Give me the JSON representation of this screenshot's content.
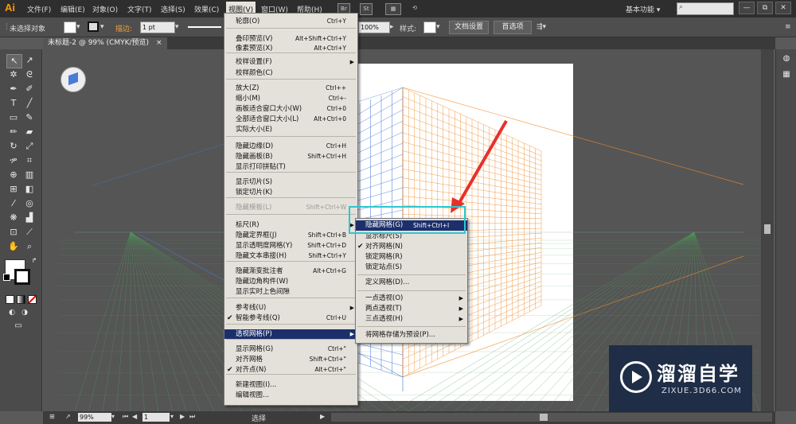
{
  "app": {
    "logo": "Ai",
    "workspace": "基本功能"
  },
  "menubar": {
    "items": [
      "文件(F)",
      "编辑(E)",
      "对象(O)",
      "文字(T)",
      "选择(S)",
      "效果(C)",
      "视图(V)",
      "窗口(W)",
      "帮助(H)"
    ],
    "toolbar_icons": [
      "Br",
      "St",
      "layout-icon",
      "sync-icon"
    ]
  },
  "window_buttons": {
    "minimize": "—",
    "restore": "⧉",
    "close": "✕"
  },
  "control_bar": {
    "selection": "未选择对象",
    "stroke_label": "描边:",
    "stroke_value": "1 pt",
    "zoom": "100%",
    "style_label": "样式:",
    "doc_settings": "文档设置",
    "preferences": "首选项"
  },
  "document_tab": {
    "title": "未标题-2 @ 99% (CMYK/预览)",
    "close": "×"
  },
  "view_menu": {
    "items": [
      {
        "label": "轮廓(O)",
        "shortcut": "Ctrl+Y"
      },
      {
        "label": "叠印预览(V)",
        "shortcut": "Alt+Shift+Ctrl+Y"
      },
      {
        "label": "像素预览(X)",
        "shortcut": "Alt+Ctrl+Y"
      },
      {
        "label": "校样设置(F)",
        "submenu": true
      },
      {
        "label": "校样颜色(C)"
      },
      {
        "label": "放大(Z)",
        "shortcut": "Ctrl++"
      },
      {
        "label": "缩小(M)",
        "shortcut": "Ctrl+-"
      },
      {
        "label": "画板适合窗口大小(W)",
        "shortcut": "Ctrl+0"
      },
      {
        "label": "全部适合窗口大小(L)",
        "shortcut": "Alt+Ctrl+0"
      },
      {
        "label": "实际大小(E)"
      },
      {
        "label": "隐藏边缘(D)",
        "shortcut": "Ctrl+H"
      },
      {
        "label": "隐藏画板(B)",
        "shortcut": "Shift+Ctrl+H"
      },
      {
        "label": "显示打印拼贴(T)"
      },
      {
        "label": "显示切片(S)"
      },
      {
        "label": "锁定切片(K)"
      },
      {
        "label": "隐藏模板(L)",
        "shortcut": "Shift+Ctrl+W",
        "disabled": true
      },
      {
        "label": "标尺(R)",
        "submenu": true
      },
      {
        "label": "隐藏定界框(J)",
        "shortcut": "Shift+Ctrl+B"
      },
      {
        "label": "显示透明度网格(Y)",
        "shortcut": "Shift+Ctrl+D"
      },
      {
        "label": "隐藏文本串接(H)",
        "shortcut": "Shift+Ctrl+Y"
      },
      {
        "label": "隐藏渐变批注者",
        "shortcut": "Alt+Ctrl+G"
      },
      {
        "label": "隐藏边角构件(W)"
      },
      {
        "label": "显示实时上色间隙"
      },
      {
        "label": "参考线(U)",
        "submenu": true
      },
      {
        "label": "智能参考线(Q)",
        "shortcut": "Ctrl+U",
        "checked": true
      },
      {
        "label": "透视网格(P)",
        "submenu": true,
        "highlighted": true
      },
      {
        "label": "显示网格(G)",
        "shortcut": "Ctrl+\""
      },
      {
        "label": "对齐网格",
        "shortcut": "Shift+Ctrl+\""
      },
      {
        "label": "对齐点(N)",
        "shortcut": "Alt+Ctrl+\"",
        "checked": true
      },
      {
        "label": "新建视图(I)..."
      },
      {
        "label": "编辑视图..."
      }
    ]
  },
  "perspective_submenu": {
    "items": [
      {
        "label": "隐藏网格(G)",
        "shortcut": "Shift+Ctrl+I",
        "highlighted": true
      },
      {
        "label": "显示标尺(S)"
      },
      {
        "label": "对齐网格(N)",
        "checked": true
      },
      {
        "label": "锁定网格(R)"
      },
      {
        "label": "锁定站点(S)"
      },
      {
        "label": "定义网格(D)..."
      },
      {
        "label": "一点透视(O)",
        "submenu": true
      },
      {
        "label": "两点透视(T)",
        "submenu": true
      },
      {
        "label": "三点透视(H)",
        "submenu": true
      },
      {
        "label": "将网格存储为预设(P)..."
      }
    ]
  },
  "status_bar": {
    "zoom": "99%",
    "page": "1",
    "tool": "选择"
  },
  "watermark": {
    "title": "溜溜自学",
    "url": "ZIXUE.3D66.COM"
  },
  "colors": {
    "accent_highlight": "#1d2f6b",
    "callout_box": "#2ec7cf",
    "arrow": "#e8302a",
    "grid_blue": "#4a7bd6",
    "grid_orange": "#f08a2a",
    "grid_green": "#4ca05a"
  }
}
